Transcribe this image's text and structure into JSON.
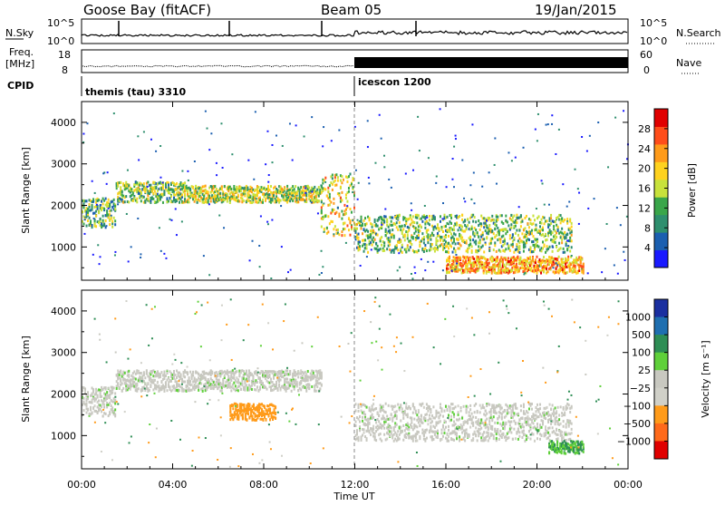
{
  "header": {
    "station": "Goose Bay (fitACF)",
    "beam": "Beam 05",
    "date": "19/Jan/2015"
  },
  "noise_panel": {
    "left_label": "N.Sky",
    "left_ticks": [
      "10^5",
      "10^0"
    ],
    "right_label": "N.Search",
    "right_ticks": [
      "10^5",
      "10^0"
    ]
  },
  "freq_panel": {
    "left_label_1": "Freq.",
    "left_label_2": "[MHz]",
    "left_ticks": [
      "18",
      "8"
    ],
    "right_label": "Nave",
    "right_ticks": [
      "60",
      "0"
    ]
  },
  "cpid_panel": {
    "label": "CPID",
    "modes": [
      "themis (tau) 3310",
      "icescon 1200"
    ]
  },
  "colors": {
    "power": [
      "#1a1aff",
      "#1b5fb0",
      "#2e8f6e",
      "#3aa64a",
      "#c8e23c",
      "#ffd21e",
      "#ff9b1a",
      "#ff4d1a",
      "#e00000"
    ],
    "velocity": [
      "#1a2fa0",
      "#1f6fb0",
      "#2e8e55",
      "#5fd03a",
      "#c8c8c0",
      "#d0d0c8",
      "#ff9b1a",
      "#ff6a1a",
      "#e00000"
    ],
    "text": "#000000"
  },
  "chart_data": [
    {
      "type": "heatmap",
      "panel": "power",
      "ylabel": "Slant Range [km]",
      "x_range_hours": [
        0,
        24
      ],
      "ylim": [
        200,
        4500
      ],
      "yticks": [
        1000,
        2000,
        3000,
        4000
      ],
      "colorbar": {
        "label": "Power [dB]",
        "range": [
          0,
          32
        ],
        "ticks": [
          "4",
          "8",
          "12",
          "16",
          "20",
          "24",
          "28"
        ]
      },
      "echo_bands": [
        {
          "t_start": 0.0,
          "t_end": 1.5,
          "range_low": 1500,
          "range_high": 2200,
          "level_db": 12
        },
        {
          "t_start": 1.5,
          "t_end": 4.5,
          "range_low": 2100,
          "range_high": 2600,
          "level_db": 14
        },
        {
          "t_start": 4.5,
          "t_end": 10.5,
          "range_low": 2100,
          "range_high": 2500,
          "level_db": 16
        },
        {
          "t_start": 10.5,
          "t_end": 12.0,
          "range_low": 1300,
          "range_high": 2800,
          "level_db": 18
        },
        {
          "t_start": 12.0,
          "t_end": 21.5,
          "range_low": 900,
          "range_high": 1800,
          "level_db": 14
        },
        {
          "t_start": 16.0,
          "t_end": 22.0,
          "range_low": 400,
          "range_high": 800,
          "level_db": 22
        }
      ]
    },
    {
      "type": "heatmap",
      "panel": "velocity",
      "ylabel": "Slant Range [km]",
      "xlabel": "Time UT",
      "x_range_hours": [
        0,
        24
      ],
      "ylim": [
        200,
        4500
      ],
      "yticks": [
        1000,
        2000,
        3000,
        4000
      ],
      "xticks": [
        "00:00",
        "04:00",
        "08:00",
        "12:00",
        "16:00",
        "20:00",
        "00:00"
      ],
      "colorbar": {
        "label": "Velocity [m s⁻¹]",
        "ticks": [
          "1000",
          "500",
          "100",
          "25",
          "−25",
          "−100",
          "−500",
          "−1000"
        ]
      },
      "echo_bands": [
        {
          "t_start": 0.0,
          "t_end": 1.5,
          "range_low": 1500,
          "range_high": 2200,
          "velocity_ms": 0
        },
        {
          "t_start": 1.5,
          "t_end": 10.5,
          "range_low": 2100,
          "range_high": 2600,
          "velocity_ms": 0
        },
        {
          "t_start": 6.5,
          "t_end": 8.5,
          "range_low": 1400,
          "range_high": 1800,
          "velocity_ms": -200
        },
        {
          "t_start": 12.0,
          "t_end": 21.5,
          "range_low": 900,
          "range_high": 1800,
          "velocity_ms": 0
        },
        {
          "t_start": 20.5,
          "t_end": 22.0,
          "range_low": 600,
          "range_high": 900,
          "velocity_ms": 100
        }
      ]
    }
  ]
}
